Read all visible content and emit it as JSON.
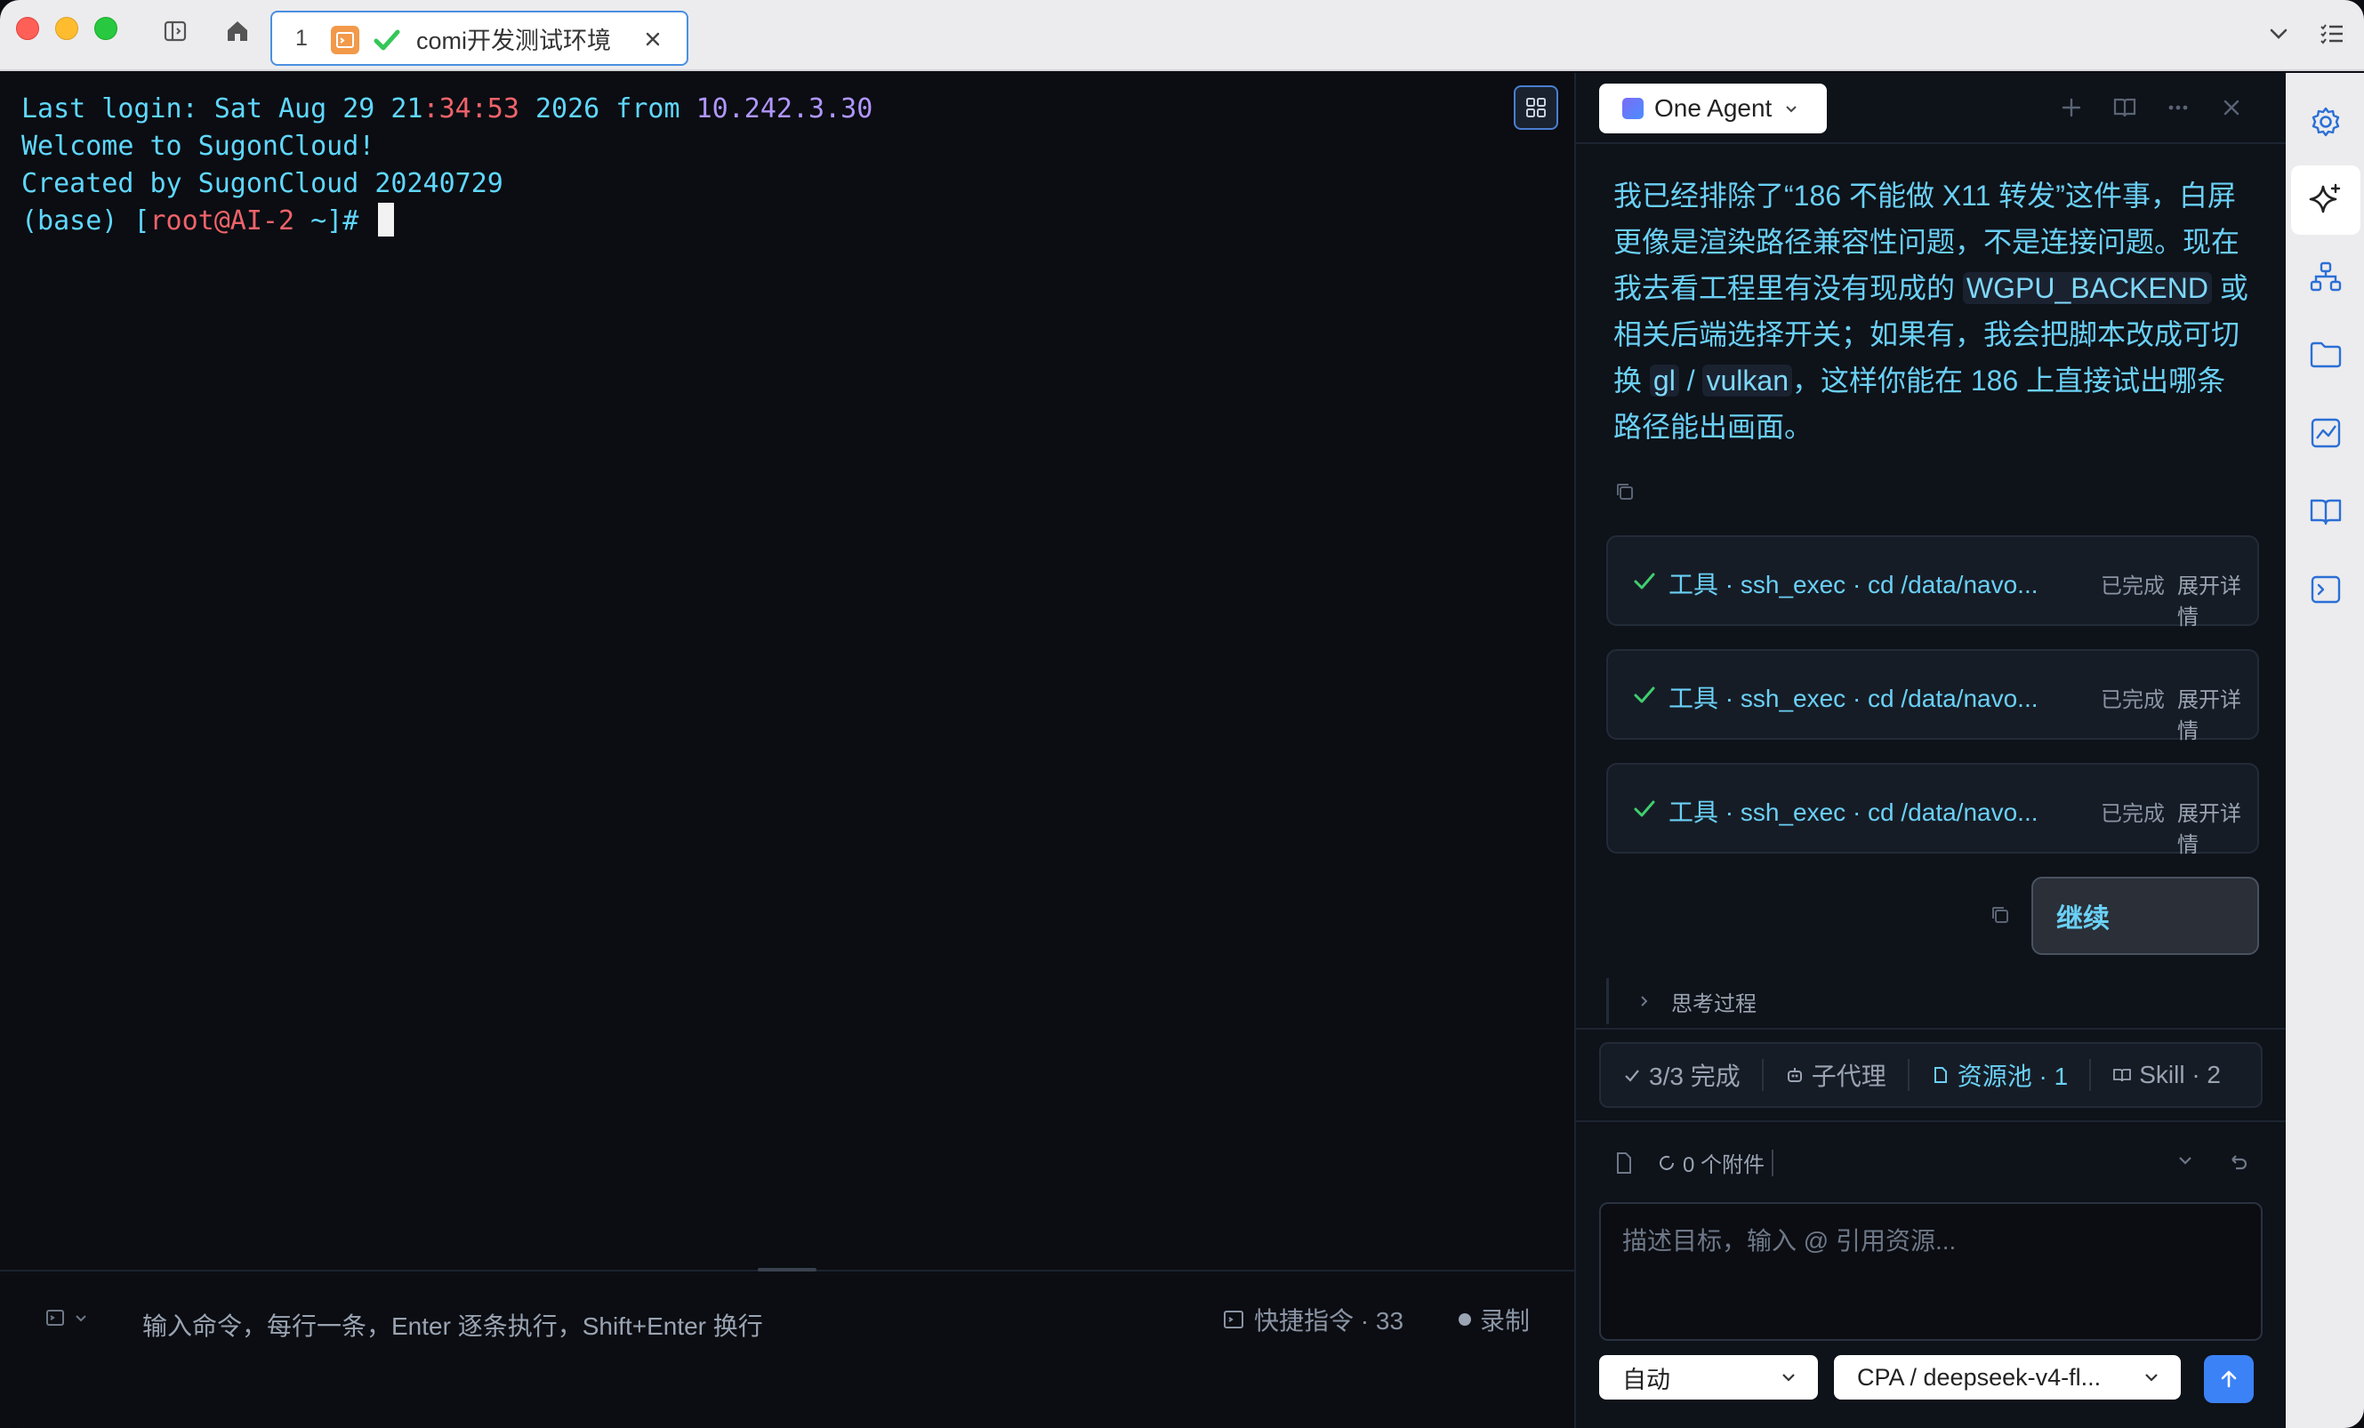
{
  "titlebar": {
    "tab": {
      "number": "1",
      "title": "comi开发测试环境"
    }
  },
  "terminal": {
    "line1": {
      "a": "Last login: Sat Aug 29 21",
      "b": ":34:53",
      "c": " 2026 from ",
      "d": "10.242.3.30"
    },
    "line2": "Welcome to SugonCloud!",
    "line3": "Created by SugonCloud 20240729",
    "line4": {
      "a": "(base) [",
      "b": "root@AI-2",
      "c": " ~]# "
    }
  },
  "terminal_footer": {
    "input_placeholder": "输入命令，每行一条，Enter 逐条执行，Shift+Enter 换行",
    "quick_commands": "快捷指令 · 33",
    "record": "录制"
  },
  "agent": {
    "selector": "One Agent",
    "message": {
      "p1": "我已经排除了“186 不能做 X11 转发”这件事，白屏更像是渲染路径兼容性问题，不是连接问题。现在我去看工程里有没有现成的 ",
      "code1": "WGPU_BACKEND",
      "p2": " 或相关后端选择开关；如果有，我会把脚本改成可切换 ",
      "code2": "gl",
      "p3": " / ",
      "code3": "vulkan",
      "p4": "，这样你能在 186 上直接试出哪条路径能出画面。"
    },
    "tools": [
      {
        "text": "工具 · ssh_exec · cd /data/navo...",
        "status": "已完成",
        "expand": "展开详情"
      },
      {
        "text": "工具 · ssh_exec · cd /data/navo...",
        "status": "已完成",
        "expand": "展开详情"
      },
      {
        "text": "工具 · ssh_exec · cd /data/navo...",
        "status": "已完成",
        "expand": "展开详情"
      }
    ],
    "user_message": "继续",
    "thinking": "思考过程",
    "status": {
      "done": "3/3 完成",
      "subagent": "子代理",
      "resources": "资源池 · 1",
      "skill": "Skill · 2"
    },
    "attachments": "0 个附件",
    "input_placeholder": "描述目标，输入 @ 引用资源...",
    "mode": "自动",
    "model": "CPA / deepseek-v4-fl..."
  },
  "colors": {
    "accent": "#3b82f6",
    "terminal_cyan": "#5fd7ff",
    "terminal_red": "#f0636a",
    "terminal_purple": "#b196ff"
  }
}
